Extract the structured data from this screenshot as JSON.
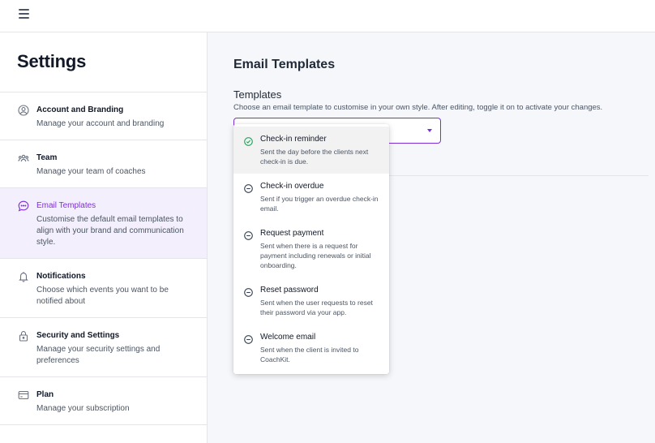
{
  "sidebar": {
    "title": "Settings",
    "items": [
      {
        "title": "Account and Branding",
        "desc": "Manage your account and branding",
        "icon": "user-circle-icon"
      },
      {
        "title": "Team",
        "desc": "Manage your team of coaches",
        "icon": "team-icon"
      },
      {
        "title": "Email Templates",
        "desc": "Customise the default email templates to align with your brand and communication style.",
        "icon": "chat-icon",
        "active": true
      },
      {
        "title": "Notifications",
        "desc": "Choose which events you want to be notified about",
        "icon": "bell-icon"
      },
      {
        "title": "Security and Settings",
        "desc": "Manage your security settings and preferences",
        "icon": "lock-icon"
      },
      {
        "title": "Plan",
        "desc": "Manage your subscription",
        "icon": "card-icon"
      }
    ]
  },
  "main": {
    "title": "Email Templates",
    "section_label": "Templates",
    "section_desc": "Choose an email template to customise in your own style. After editing, toggle it on to activate your changes.",
    "select_value": ""
  },
  "dropdown": {
    "options": [
      {
        "title": "Check-in reminder",
        "desc": "Sent the day before the clients next check-in is due.",
        "status": "enabled"
      },
      {
        "title": "Check-in overdue",
        "desc": "Sent if you trigger an overdue check-in email.",
        "status": "disabled"
      },
      {
        "title": "Request payment",
        "desc": "Sent when there is a request for payment including renewals or initial onboarding.",
        "status": "disabled"
      },
      {
        "title": "Reset password",
        "desc": "Sent when the user requests to reset their password via your app.",
        "status": "disabled"
      },
      {
        "title": "Welcome email",
        "desc": "Sent when the client is invited to CoachKit.",
        "status": "disabled"
      }
    ]
  },
  "colors": {
    "accent": "#7c2fd6",
    "active_bg": "#f4effc",
    "success": "#22a35a",
    "main_bg": "#f6f7fa"
  }
}
